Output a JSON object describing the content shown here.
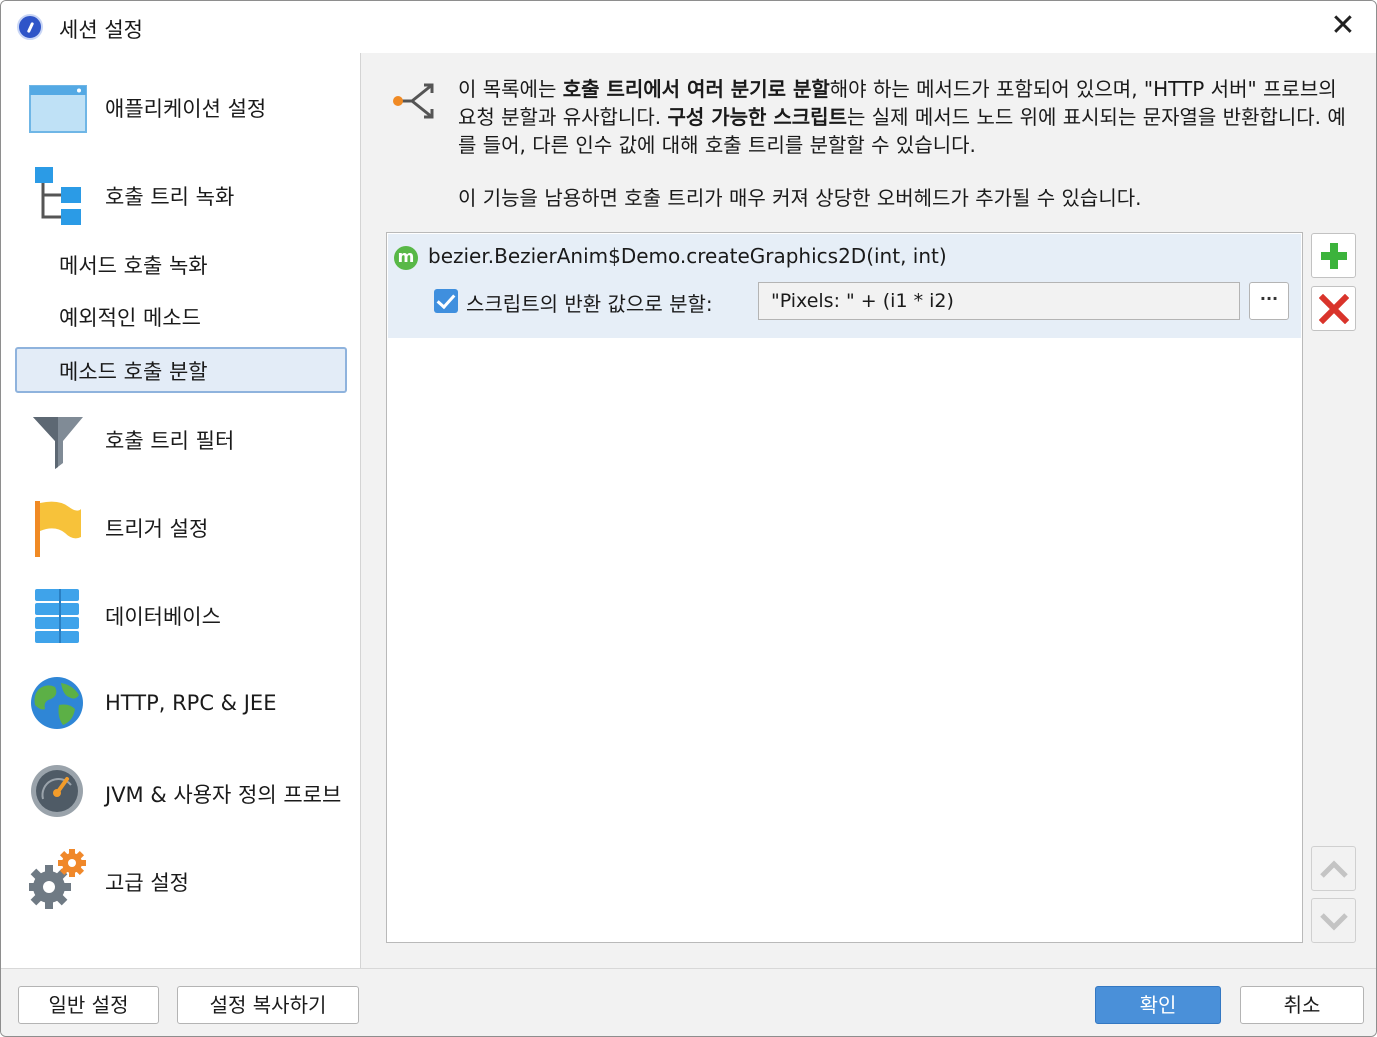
{
  "window": {
    "title": "세션 설정"
  },
  "sidebar": {
    "items": [
      {
        "label": "애플리케이션 설정",
        "icon": "application-window-icon"
      },
      {
        "label": "호출 트리 녹화",
        "icon": "call-tree-icon"
      },
      {
        "label": "메서드 호출 녹화",
        "sub": true
      },
      {
        "label": "예외적인 메소드",
        "sub": true
      },
      {
        "label": "메소드 호출 분할",
        "sub": true,
        "selected": true
      },
      {
        "label": "호출 트리 필터",
        "icon": "funnel-icon"
      },
      {
        "label": "트리거 설정",
        "icon": "flag-icon"
      },
      {
        "label": "데이터베이스",
        "icon": "database-icon"
      },
      {
        "label": "HTTP, RPC & JEE",
        "icon": "globe-icon"
      },
      {
        "label": "JVM & 사용자 정의 프로브",
        "icon": "gauge-icon"
      },
      {
        "label": "고급 설정",
        "icon": "gears-icon"
      }
    ]
  },
  "main": {
    "desc_p1_a": "이 목록에는 ",
    "desc_p1_b": "호출 트리에서 여러 분기로 분할",
    "desc_p1_c": "해야 하는 메서드가 포함되어 있으며, \"HTTP 서버\" 프로브의 요청 분할과 유사합니다. ",
    "desc_p1_d": "구성 가능한 스크립트",
    "desc_p1_e": "는 실제 메서드 노드 위에 표시되는 문자열을 반환합니다. 예를 들어, 다른 인수 값에 대해 호출 트리를 분할할 수 있습니다.",
    "desc_p2": "이 기능을 남용하면 호출 트리가 매우 커져 상당한 오버헤드가 추가될 수 있습니다.",
    "list": {
      "method_badge": "m",
      "method": "bezier.BezierAnim$Demo.createGraphics2D(int, int)",
      "checkbox_label": "스크립트의 반환 값으로 분할:",
      "checkbox_checked": true,
      "script_value": "\"Pixels: \" + (i1 * i2)",
      "dots_label": "···"
    }
  },
  "footer": {
    "general_settings": "일반 설정",
    "copy_settings": "설정 복사하기",
    "ok": "확인",
    "cancel": "취소"
  },
  "colors": {
    "accent": "#4a90d9",
    "selection": "#e3ecf7",
    "add": "#3cb33c",
    "remove": "#d9342b"
  }
}
